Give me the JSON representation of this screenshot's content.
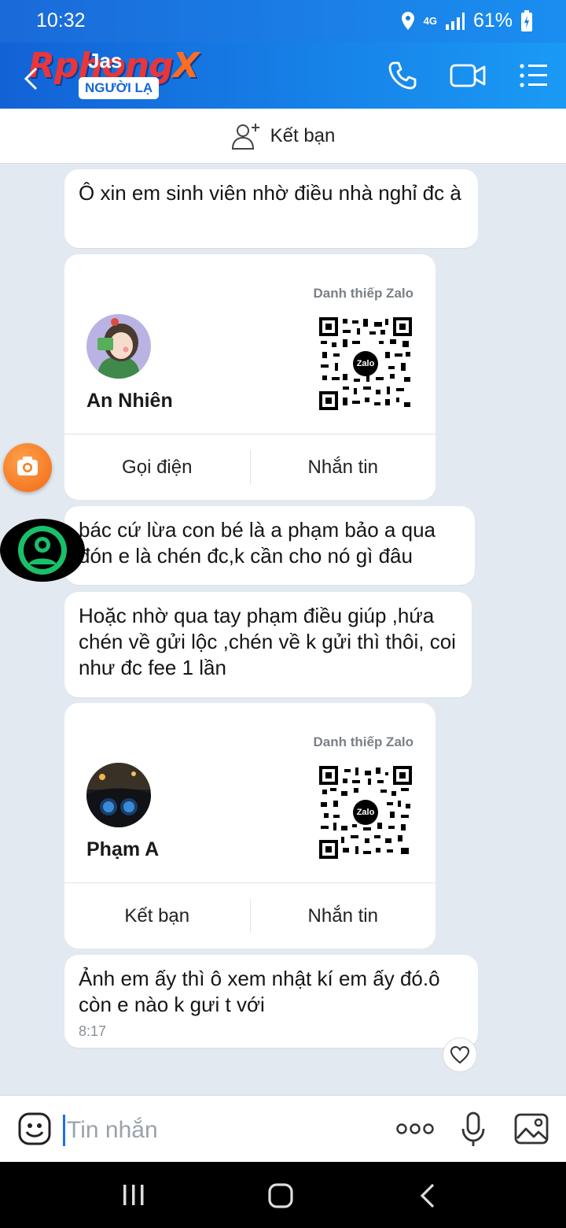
{
  "status": {
    "time": "10:32",
    "network": "4G",
    "battery": "61%"
  },
  "header": {
    "brand": "Rphong",
    "brand_x": "X",
    "contact_name": "Jas",
    "badge": "NGƯỜI LẠ"
  },
  "add_friend": {
    "label": "Kết bạn"
  },
  "messages": [
    {
      "text": "Ô xin em sinh viên nhờ điều nhà nghỉ đc à"
    },
    {
      "text": "bác cứ lừa con bé là a phạm bảo a qua đón e là chén đc,k cần cho nó gì đâu"
    },
    {
      "text": "Hoặc nhờ qua tay phạm điều giúp ,hứa chén về gửi lộc ,chén về k gửi thì thôi, coi như đc fee 1 lần"
    },
    {
      "text": "Ảnh em ấy thì ô xem nhật kí em ấy đó.ô còn e nào k gưi t với",
      "time": "8:17"
    }
  ],
  "cards": [
    {
      "label": "Danh thiếp Zalo",
      "name": "An Nhiên",
      "action_left": "Gọi điện",
      "action_right": "Nhắn tin",
      "qr_center": "Zalo"
    },
    {
      "label": "Danh thiếp Zalo",
      "name": "Phạm A",
      "action_left": "Kết bạn",
      "action_right": "Nhắn tin",
      "qr_center": "Zalo"
    }
  ],
  "input": {
    "placeholder": "Tin nhắn"
  },
  "icons": {
    "header": [
      "back-icon",
      "phone-icon",
      "video-icon",
      "menu-icon"
    ],
    "input": [
      "emoji-icon",
      "more-icon",
      "mic-icon",
      "image-icon"
    ],
    "nav": [
      "recents-icon",
      "home-icon",
      "back-nav-icon"
    ]
  },
  "colors": {
    "header_start": "#1262d6",
    "header_end": "#1a9af5",
    "chat_bg": "#e2e9f1",
    "accent": "#1a73e8",
    "camera": "#f26a14",
    "logo_green": "#19c06a"
  }
}
